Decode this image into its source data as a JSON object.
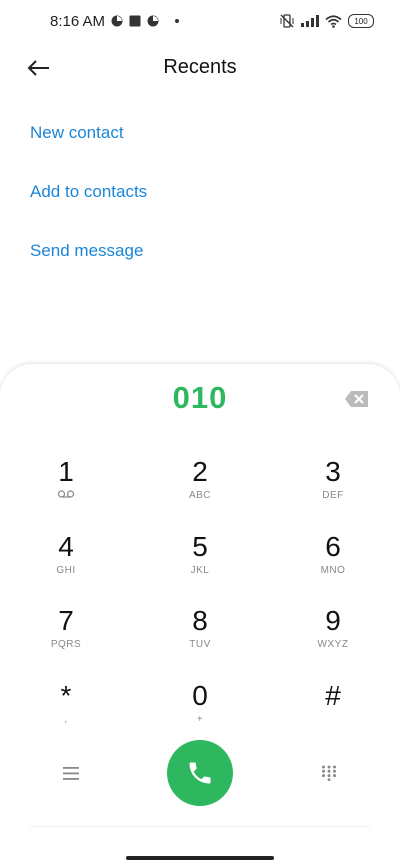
{
  "status_bar": {
    "time": "8:16 AM",
    "battery": "100",
    "icons": [
      "vibrate-off-icon",
      "signal-icon",
      "wifi-icon",
      "battery-icon"
    ]
  },
  "header": {
    "title": "Recents",
    "back_icon": "arrow-left-icon"
  },
  "actions": [
    {
      "label": "New contact"
    },
    {
      "label": "Add to contacts"
    },
    {
      "label": "Send message"
    }
  ],
  "dialpad": {
    "number": "010",
    "keys": [
      {
        "digit": "1",
        "letters": ""
      },
      {
        "digit": "2",
        "letters": "ABC"
      },
      {
        "digit": "3",
        "letters": "DEF"
      },
      {
        "digit": "4",
        "letters": "GHI"
      },
      {
        "digit": "5",
        "letters": "JKL"
      },
      {
        "digit": "6",
        "letters": "MNO"
      },
      {
        "digit": "7",
        "letters": "PQRS"
      },
      {
        "digit": "8",
        "letters": "TUV"
      },
      {
        "digit": "9",
        "letters": "WXYZ"
      },
      {
        "digit": "*",
        "letters": ","
      },
      {
        "digit": "0",
        "letters": "+"
      },
      {
        "digit": "#",
        "letters": ""
      }
    ]
  },
  "colors": {
    "accent_blue": "#1b86d8",
    "call_green": "#2fb75f"
  }
}
